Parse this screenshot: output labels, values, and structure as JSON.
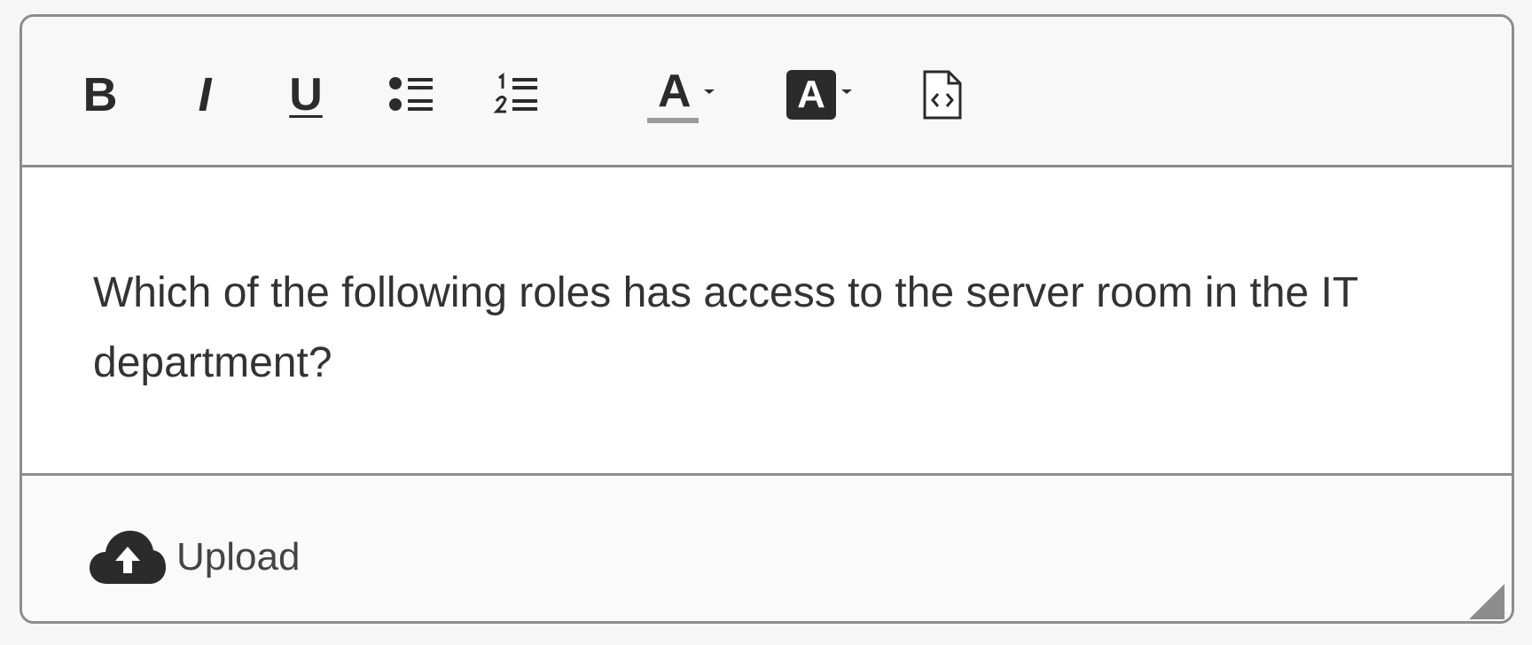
{
  "toolbar": {
    "buttons": [
      {
        "name": "bold",
        "glyph": "B",
        "icon": "bold-icon"
      },
      {
        "name": "italic",
        "glyph": "I",
        "icon": "italic-icon"
      },
      {
        "name": "underline",
        "glyph": "U",
        "icon": "underline-icon"
      },
      {
        "name": "bullet-list",
        "icon": "bullet-list-icon"
      },
      {
        "name": "numbered-list",
        "icon": "numbered-list-icon"
      },
      {
        "name": "text-color",
        "glyph": "A",
        "icon": "text-color-icon",
        "has_dropdown": true
      },
      {
        "name": "highlight-color",
        "glyph": "A",
        "icon": "highlight-color-icon",
        "has_dropdown": true
      },
      {
        "name": "source-code",
        "icon": "source-code-icon"
      }
    ]
  },
  "editor": {
    "content": "Which of the following roles has access to the server room in the IT department?"
  },
  "footer": {
    "upload_label": "Upload",
    "upload_icon": "cloud-upload-icon"
  },
  "colors": {
    "border": "#8c8c8c",
    "text": "#333333",
    "icon": "#2b2b2b",
    "underline_accent": "#9a9a9a",
    "background": "#fafafa"
  }
}
